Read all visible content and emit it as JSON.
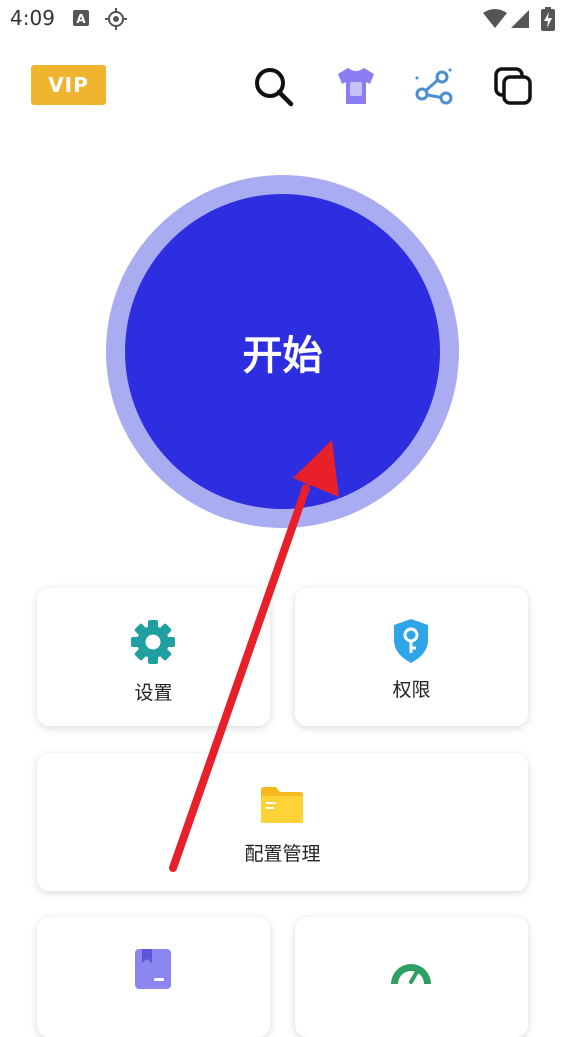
{
  "status_bar": {
    "time": "4:09",
    "icons": [
      "text-notification-icon",
      "location-icon",
      "wifi-icon",
      "signal-icon",
      "battery-charging-icon"
    ]
  },
  "header": {
    "vip_label": "VIP",
    "icons": [
      "search-icon",
      "theme-shirt-icon",
      "share-icon",
      "copy-icon"
    ]
  },
  "main": {
    "start_button_label": "开始"
  },
  "cards": {
    "settings": {
      "label": "设置",
      "icon": "gear-icon"
    },
    "permissions": {
      "label": "权限",
      "icon": "key-shield-icon"
    },
    "config_management": {
      "label": "配置管理",
      "icon": "folder-icon"
    },
    "bottom_left": {
      "label": "",
      "icon": "bookmark-card-icon"
    },
    "bottom_right": {
      "label": "",
      "icon": "speedometer-icon"
    }
  },
  "colors": {
    "accent": "#2d2ee0",
    "ring": "#a9acf0",
    "vip": "#efb530",
    "annotation_arrow": "#e8202a"
  }
}
